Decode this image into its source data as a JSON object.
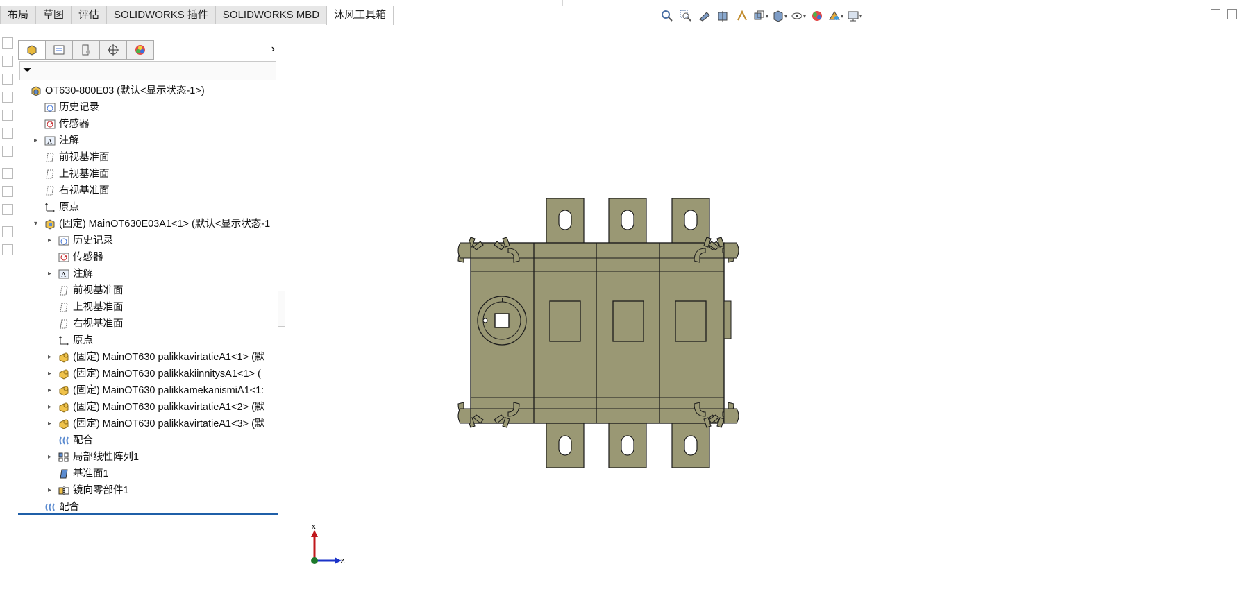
{
  "ribbon": {
    "tabs": [
      {
        "label": "布局"
      },
      {
        "label": "草图"
      },
      {
        "label": "评估"
      },
      {
        "label": "SOLIDWORKS 插件"
      },
      {
        "label": "SOLIDWORKS MBD"
      },
      {
        "label": "沐风工具箱",
        "active": true
      }
    ]
  },
  "view_toolbar": {
    "icons": [
      "zoom-to-fit-icon",
      "zoom-area-icon",
      "previous-view-icon",
      "section-view-icon",
      "dynamic-annotation-icon",
      "view-orientation-icon",
      "display-style-icon",
      "hide-show-icon",
      "edit-appearance-icon",
      "apply-scene-icon",
      "view-settings-icon"
    ]
  },
  "feature_manager": {
    "tabs": [
      "feature-tree-tab",
      "property-tab",
      "configuration-tab",
      "dimxpert-tab",
      "display-tab"
    ],
    "tree": [
      {
        "label": "OT630-800E03  (默认<显示状态-1>)",
        "level": 0,
        "icon": "assembly-icon",
        "expander": ""
      },
      {
        "label": "历史记录",
        "level": 1,
        "icon": "history-icon",
        "expander": ""
      },
      {
        "label": "传感器",
        "level": 1,
        "icon": "sensor-icon",
        "expander": ""
      },
      {
        "label": "注解",
        "level": 1,
        "icon": "annotation-icon",
        "expander": "▸"
      },
      {
        "label": "前视基准面",
        "level": 1,
        "icon": "plane-icon",
        "expander": ""
      },
      {
        "label": "上视基准面",
        "level": 1,
        "icon": "plane-icon",
        "expander": ""
      },
      {
        "label": "右视基准面",
        "level": 1,
        "icon": "plane-icon",
        "expander": ""
      },
      {
        "label": "原点",
        "level": 1,
        "icon": "origin-icon",
        "expander": ""
      },
      {
        "label": "(固定) MainOT630E03A1<1> (默认<显示状态-1",
        "level": 1,
        "icon": "subassembly-icon",
        "expander": "▾"
      },
      {
        "label": "历史记录",
        "level": 2,
        "icon": "history-icon",
        "expander": "▸"
      },
      {
        "label": "传感器",
        "level": 2,
        "icon": "sensor-icon",
        "expander": ""
      },
      {
        "label": "注解",
        "level": 2,
        "icon": "annotation-icon",
        "expander": "▸"
      },
      {
        "label": "前视基准面",
        "level": 2,
        "icon": "plane-icon",
        "expander": ""
      },
      {
        "label": "上视基准面",
        "level": 2,
        "icon": "plane-icon",
        "expander": ""
      },
      {
        "label": "右视基准面",
        "level": 2,
        "icon": "plane-icon",
        "expander": ""
      },
      {
        "label": "原点",
        "level": 2,
        "icon": "origin-icon",
        "expander": ""
      },
      {
        "label": "(固定) MainOT630 palikkavirtatieA1<1> (默",
        "level": 2,
        "icon": "part-icon",
        "expander": "▸"
      },
      {
        "label": "(固定) MainOT630 palikkakiinnitysA1<1> (",
        "level": 2,
        "icon": "part-icon",
        "expander": "▸"
      },
      {
        "label": "(固定) MainOT630 palikkamekanismiA1<1:",
        "level": 2,
        "icon": "part-icon",
        "expander": "▸"
      },
      {
        "label": "(固定) MainOT630 palikkavirtatieA1<2> (默",
        "level": 2,
        "icon": "part-icon",
        "expander": "▸"
      },
      {
        "label": "(固定) MainOT630 palikkavirtatieA1<3> (默",
        "level": 2,
        "icon": "part-icon",
        "expander": "▸"
      },
      {
        "label": "配合",
        "level": 2,
        "icon": "mate-icon",
        "expander": ""
      },
      {
        "label": "局部线性阵列1",
        "level": 2,
        "icon": "linear-pattern-icon",
        "expander": "▸"
      },
      {
        "label": "基准面1",
        "level": 2,
        "icon": "reference-plane-icon",
        "expander": ""
      },
      {
        "label": "镜向零部件1",
        "level": 2,
        "icon": "mirror-component-icon",
        "expander": "▸"
      },
      {
        "label": "配合",
        "level": 1,
        "icon": "mate-icon",
        "expander": ""
      }
    ]
  },
  "triad": {
    "x_label": "X",
    "z_label": "Z"
  },
  "colors": {
    "part_body": "#9a9874",
    "part_outline": "#1c1c1c",
    "selection_bar": "#1f5fa8",
    "triad_x": "#c0181c",
    "triad_z": "#1b33c8",
    "triad_origin": "#1d7a2c"
  }
}
